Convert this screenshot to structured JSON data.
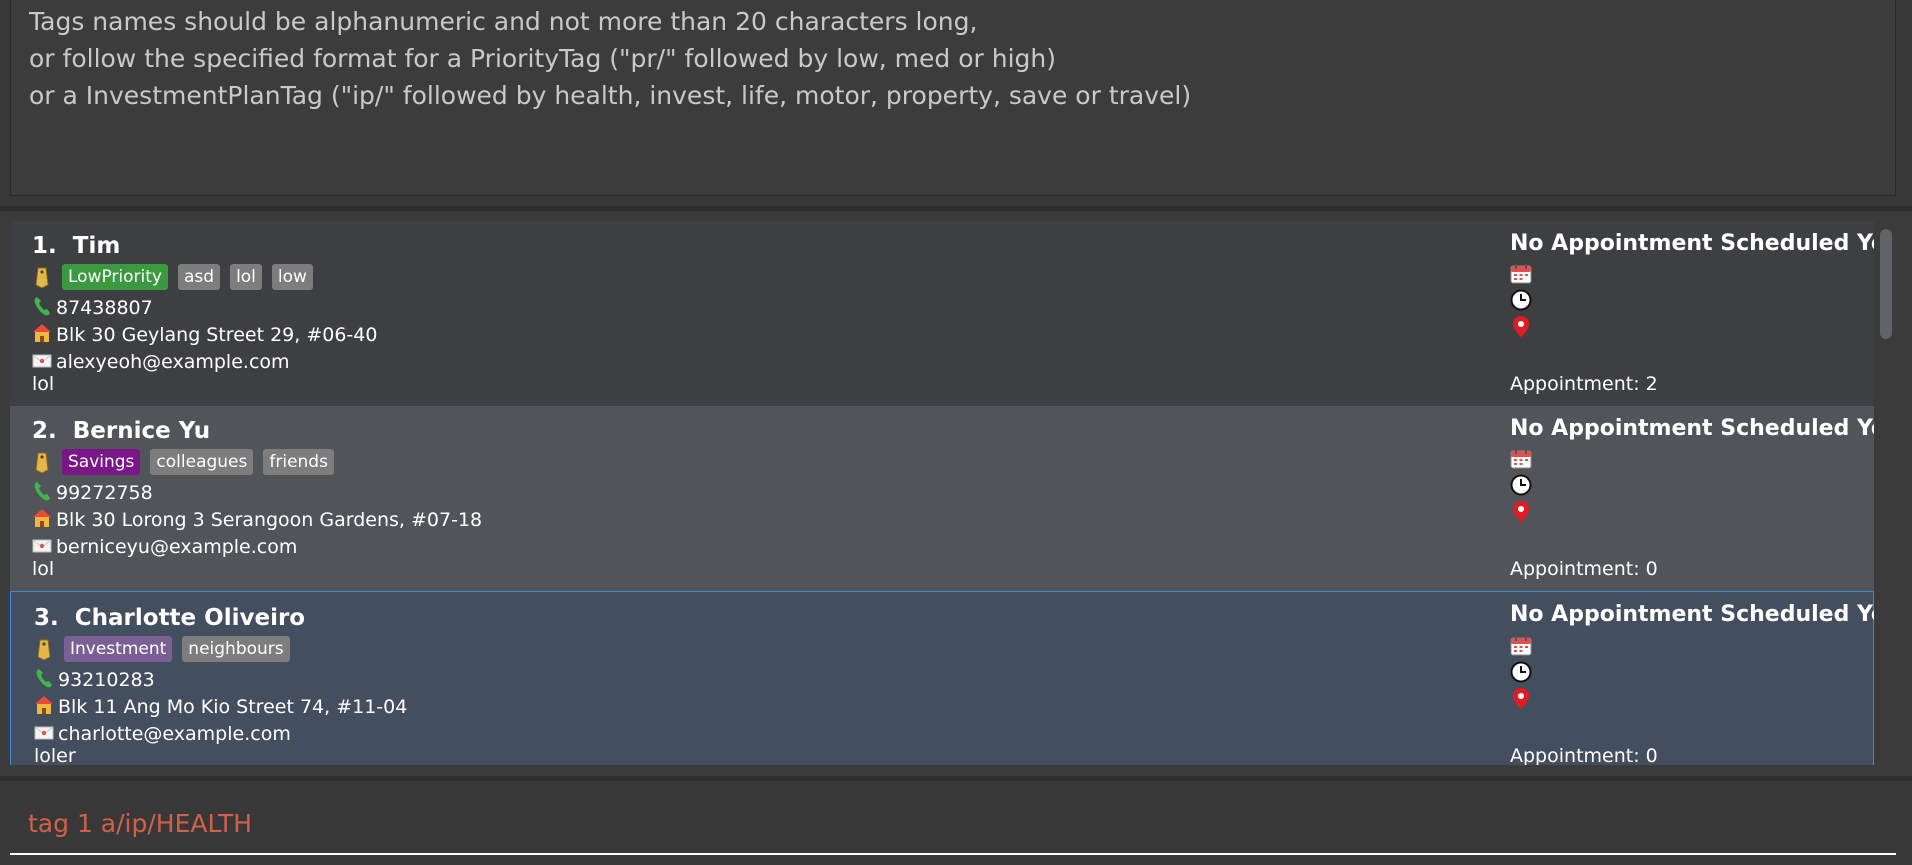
{
  "result": {
    "lines": [
      "Tags names should be alphanumeric and not more than 20 characters long,",
      "or follow the specified format for a PriorityTag (\"pr/\" followed by low, med or high)",
      "or a InvestmentPlanTag (\"ip/\" followed by health, invest, life, motor, property, save or travel)"
    ]
  },
  "persons": [
    {
      "index": "1.",
      "name": "Tim",
      "tags": [
        {
          "label": "LowPriority",
          "color": "#3b9a40"
        },
        {
          "label": "asd",
          "color": "#7d7d7d"
        },
        {
          "label": "lol",
          "color": "#7d7d7d"
        },
        {
          "label": "low",
          "color": "#7d7d7d"
        }
      ],
      "phone": "87438807",
      "address": "Blk 30 Geylang Street 29, #06-40",
      "email": "alexyeoh@example.com",
      "remark": "lol",
      "appointment_status": "No Appointment Scheduled Yet",
      "appointment_count": "Appointment: 2"
    },
    {
      "index": "2.",
      "name": "Bernice Yu",
      "tags": [
        {
          "label": "Savings",
          "color": "#7a1687"
        },
        {
          "label": "colleagues",
          "color": "#7d7d7d"
        },
        {
          "label": "friends",
          "color": "#7d7d7d"
        }
      ],
      "phone": "99272758",
      "address": "Blk 30 Lorong 3 Serangoon Gardens, #07-18",
      "email": "berniceyu@example.com",
      "remark": "lol",
      "appointment_status": "No Appointment Scheduled Yet",
      "appointment_count": "Appointment: 0"
    },
    {
      "index": "3.",
      "name": "Charlotte Oliveiro",
      "tags": [
        {
          "label": "Investment",
          "color": "#7a5f95"
        },
        {
          "label": "neighbours",
          "color": "#7d7d7d"
        }
      ],
      "phone": "93210283",
      "address": "Blk 11 Ang Mo Kio Street 74, #11-04",
      "email": "charlotte@example.com",
      "remark": "loler",
      "appointment_status": "No Appointment Scheduled Yet",
      "appointment_count": "Appointment: 0"
    }
  ],
  "command": {
    "value": "tag 1 a/ip/HEALTH"
  },
  "icons": {
    "tag": "tag-icon",
    "phone": "phone-icon",
    "address": "house-icon",
    "email": "envelope-icon",
    "date": "calendar-icon",
    "time": "clock-icon",
    "location": "location-pin-icon"
  }
}
